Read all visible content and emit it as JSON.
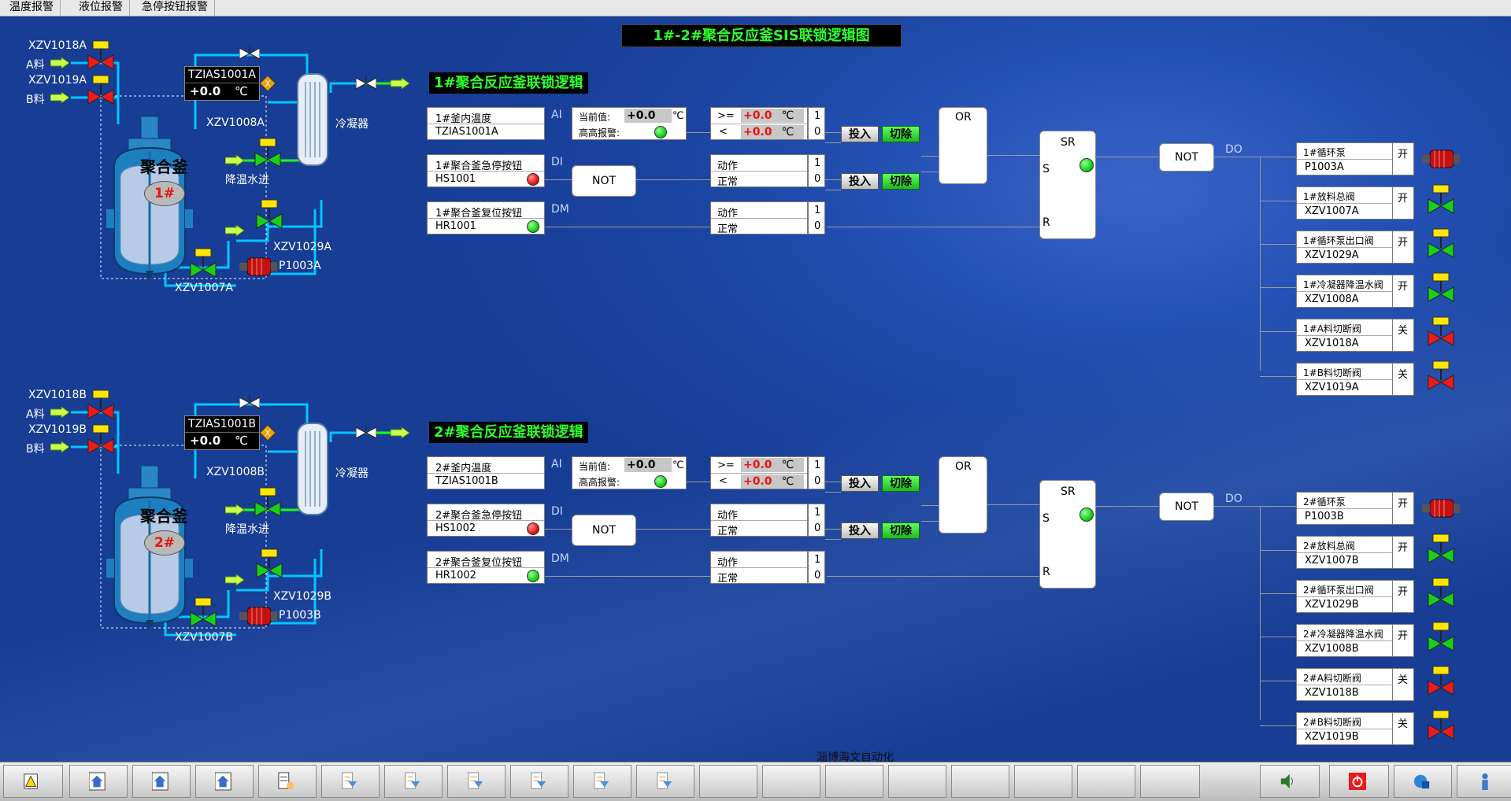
{
  "menu": [
    "温度报警",
    "液位报警",
    "急停按钮报警"
  ],
  "main_title": "1#-2#聚合反应釜SIS联锁逻辑图",
  "footer": "淄博海文自动化",
  "labels": {
    "current": "当前值:",
    "hh_alarm": "高高报警:",
    "unit": "℃",
    "ge": ">=",
    "lt": "<",
    "action": "动作",
    "normal": "正常",
    "one": "1",
    "zero": "0",
    "btn_in": "投入",
    "btn_out": "切除",
    "or": "OR",
    "not": "NOT",
    "sr": "SR",
    "s": "S",
    "r": "R",
    "ai": "AI",
    "di": "DI",
    "dm": "DM",
    "do": "DO",
    "value": "+0.0",
    "reactor": "聚合釜",
    "condenser": "冷凝器",
    "cooling": "降温水进",
    "a_feed": "A料",
    "b_feed": "B料",
    "open": "开",
    "close": "关"
  },
  "units": [
    {
      "title": "1#聚合反应釜联锁逻辑",
      "reactor_no": "1#",
      "temp_name": "1#釜内温度",
      "temp_tag": "TZIAS1001A",
      "estop_name": "1#聚合釜急停按钮",
      "estop_tag": "HS1001",
      "reset_name": "1#聚合釜复位按钮",
      "reset_tag": "HR1001",
      "v_a": "XZV1018A",
      "v_b": "XZV1019A",
      "v_cool": "XZV1008A",
      "v_out": "XZV1029A",
      "v_bot": "XZV1007A",
      "pump": "P1003A",
      "outputs": [
        {
          "name": "1#循环泵",
          "tag": "P1003A",
          "state": "开"
        },
        {
          "name": "1#放料总阀",
          "tag": "XZV1007A",
          "state": "开"
        },
        {
          "name": "1#循环泵出口阀",
          "tag": "XZV1029A",
          "state": "开"
        },
        {
          "name": "1#冷凝器降温水阀",
          "tag": "XZV1008A",
          "state": "开"
        },
        {
          "name": "1#A料切断阀",
          "tag": "XZV1018A",
          "state": "关"
        },
        {
          "name": "1#B料切断阀",
          "tag": "XZV1019A",
          "state": "关"
        }
      ]
    },
    {
      "title": "2#聚合反应釜联锁逻辑",
      "reactor_no": "2#",
      "temp_name": "2#釜内温度",
      "temp_tag": "TZIAS1001B",
      "estop_name": "2#聚合釜急停按钮",
      "estop_tag": "HS1002",
      "reset_name": "2#聚合釜复位按钮",
      "reset_tag": "HR1002",
      "v_a": "XZV1018B",
      "v_b": "XZV1019B",
      "v_cool": "XZV1008B",
      "v_out": "XZV1029B",
      "v_bot": "XZV1007B",
      "pump": "P1003B",
      "outputs": [
        {
          "name": "2#循环泵",
          "tag": "P1003B",
          "state": "开"
        },
        {
          "name": "2#放料总阀",
          "tag": "XZV1007B",
          "state": "开"
        },
        {
          "name": "2#循环泵出口阀",
          "tag": "XZV1029B",
          "state": "开"
        },
        {
          "name": "2#冷凝器降温水阀",
          "tag": "XZV1008B",
          "state": "开"
        },
        {
          "name": "2#A料切断阀",
          "tag": "XZV1018B",
          "state": "关"
        },
        {
          "name": "2#B料切断阀",
          "tag": "XZV1019B",
          "state": "关"
        }
      ]
    }
  ],
  "colors": {
    "accent_green": "#2cff2c",
    "alarm_red": "#ee1111",
    "pipe": "#00c8ff",
    "valve_open": "#18d018",
    "valve_closed": "#ee1a1a"
  },
  "taskbar_icons": [
    "alarm-icon",
    "home-icon",
    "home-icon",
    "home-icon",
    "grid-icon",
    "nav-icon",
    "nav-icon",
    "nav-icon",
    "nav-icon",
    "nav-icon",
    "nav-icon",
    "blank",
    "blank",
    "blank",
    "blank",
    "blank",
    "blank",
    "blank",
    "blank",
    "speaker-icon",
    "power-icon",
    "network-icon",
    "user-icon"
  ]
}
